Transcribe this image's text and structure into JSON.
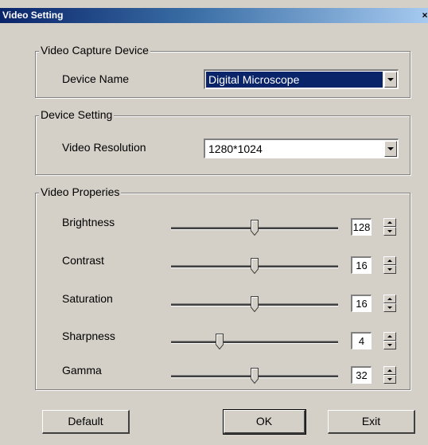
{
  "window": {
    "title": "Video Setting",
    "close": "×"
  },
  "capture": {
    "group_label": "Video Capture Device",
    "device_name_label": "Device Name",
    "device_name_value": "Digital Microscope"
  },
  "device_setting": {
    "group_label": "Device Setting",
    "resolution_label": "Video Resolution",
    "resolution_value": "1280*1024"
  },
  "properties": {
    "group_label": "Video Properies",
    "items": [
      {
        "label": "Brightness",
        "value": "128",
        "level": 0.5
      },
      {
        "label": "Contrast",
        "value": "16",
        "level": 0.5
      },
      {
        "label": "Saturation",
        "value": "16",
        "level": 0.5
      },
      {
        "label": "Sharpness",
        "value": "4",
        "level": 0.29
      },
      {
        "label": "Gamma",
        "value": "32",
        "level": 0.5
      }
    ]
  },
  "buttons": {
    "default": "Default",
    "ok": "OK",
    "exit": "Exit"
  }
}
